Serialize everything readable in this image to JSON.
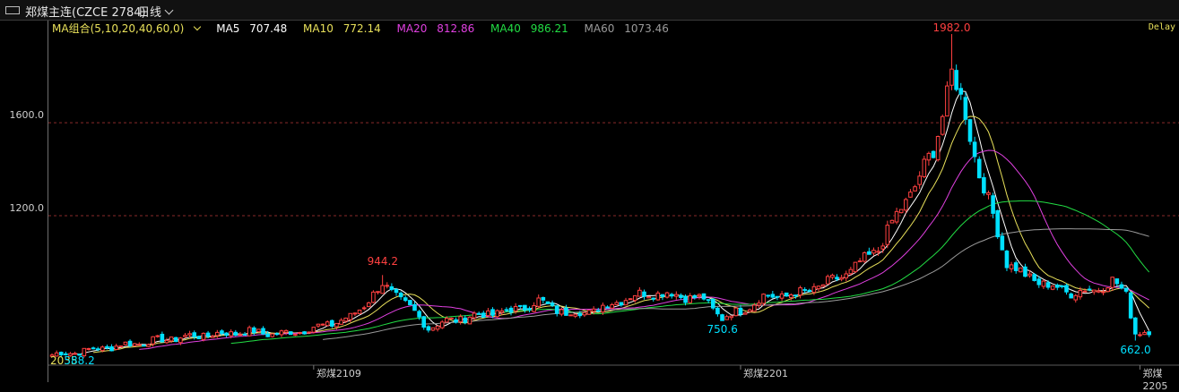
{
  "header": {
    "title": "郑煤主连(CZCE 2784)",
    "period": "日线"
  },
  "legend": {
    "group": "MA组合(5,10,20,40,60,0)",
    "items": [
      {
        "label": "MA5",
        "value": "707.48",
        "color": "#ffffff"
      },
      {
        "label": "MA10",
        "value": "772.14",
        "color": "#e8e05a"
      },
      {
        "label": "MA20",
        "value": "812.86",
        "color": "#e040e0"
      },
      {
        "label": "MA40",
        "value": "986.21",
        "color": "#22dd44"
      },
      {
        "label": "MA60",
        "value": "1073.46",
        "color": "#9a9a9a"
      }
    ]
  },
  "status": {
    "delay": "Delay"
  },
  "colors": {
    "up": "#ff4040",
    "down": "#00e0ff",
    "grid": "#8a2a2a",
    "axis": "#6e6e6e"
  },
  "chart_data": {
    "type": "candlestick",
    "ylim": [
      560,
      2040
    ],
    "y_ticks": [
      {
        "label": "1600.0",
        "value": 1600
      },
      {
        "label": "1200.0",
        "value": 1200
      }
    ],
    "x_labels": [
      {
        "label": "郑煤2109",
        "index": 57
      },
      {
        "label": "郑煤2201",
        "index": 150
      },
      {
        "label": "郑煤2205",
        "index": 237
      }
    ],
    "annotations": [
      {
        "text": "944.2",
        "index": 72,
        "value": 944.2,
        "pos": "above",
        "color": "#ff4040"
      },
      {
        "text": "750.6",
        "index": 146,
        "value": 750.6,
        "pos": "below",
        "color": "#00e0ff"
      },
      {
        "text": "1982.0",
        "index": 196,
        "value": 1982.0,
        "pos": "above",
        "color": "#ff4040"
      },
      {
        "text": "662.0",
        "index": 236,
        "value": 662.0,
        "pos": "below",
        "color": "#00e0ff"
      },
      {
        "text": "2035",
        "index": 0,
        "value": 588,
        "pos": "corner",
        "color": "#e8e05a"
      },
      {
        "text": "588.2",
        "index": 3,
        "value": 588.2,
        "pos": "corner",
        "color": "#00e0ff"
      }
    ],
    "anchors": [
      [
        0,
        600
      ],
      [
        8,
        620
      ],
      [
        18,
        650
      ],
      [
        30,
        680
      ],
      [
        42,
        700
      ],
      [
        50,
        690
      ],
      [
        58,
        720
      ],
      [
        65,
        760
      ],
      [
        72,
        900
      ],
      [
        75,
        860
      ],
      [
        78,
        800
      ],
      [
        82,
        720
      ],
      [
        86,
        745
      ],
      [
        92,
        770
      ],
      [
        100,
        790
      ],
      [
        106,
        830
      ],
      [
        112,
        780
      ],
      [
        118,
        790
      ],
      [
        124,
        840
      ],
      [
        130,
        870
      ],
      [
        136,
        860
      ],
      [
        142,
        840
      ],
      [
        146,
        760
      ],
      [
        150,
        790
      ],
      [
        155,
        850
      ],
      [
        162,
        860
      ],
      [
        168,
        900
      ],
      [
        174,
        960
      ],
      [
        180,
        1060
      ],
      [
        184,
        1200
      ],
      [
        188,
        1330
      ],
      [
        192,
        1480
      ],
      [
        196,
        1810
      ],
      [
        199,
        1640
      ],
      [
        202,
        1380
      ],
      [
        205,
        1200
      ],
      [
        208,
        1000
      ],
      [
        212,
        940
      ],
      [
        217,
        900
      ],
      [
        222,
        870
      ],
      [
        227,
        880
      ],
      [
        231,
        920
      ],
      [
        234,
        860
      ],
      [
        236,
        700
      ],
      [
        239,
        695
      ]
    ],
    "ma": [
      {
        "name": "MA5",
        "period": 5,
        "color": "#ffffff"
      },
      {
        "name": "MA10",
        "period": 10,
        "color": "#e8e05a"
      },
      {
        "name": "MA20",
        "period": 20,
        "color": "#e040e0"
      },
      {
        "name": "MA40",
        "period": 40,
        "color": "#22dd44"
      },
      {
        "name": "MA60",
        "period": 60,
        "color": "#9a9a9a"
      }
    ]
  }
}
